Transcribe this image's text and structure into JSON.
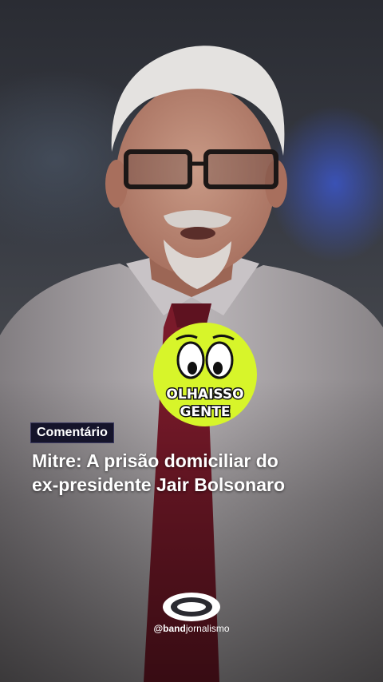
{
  "overlay": {
    "badge_line1": "OLHAISSO",
    "badge_line2": "GENTE",
    "tag_label": "Comentário",
    "headline_line1": "Mitre: A prisão domiciliar do",
    "headline_line2": "ex-presidente Jair Bolsonaro",
    "handle_prefix": "@band",
    "handle_suffix": "jornalismo"
  },
  "colors": {
    "badge_fill": "#d7f52a",
    "tag_background": "#15142a",
    "tie": "#7a1a2a",
    "screen_glow": "#3c5adc"
  },
  "icons": [
    "cartoon-eyes-icon",
    "band-logo-icon"
  ]
}
